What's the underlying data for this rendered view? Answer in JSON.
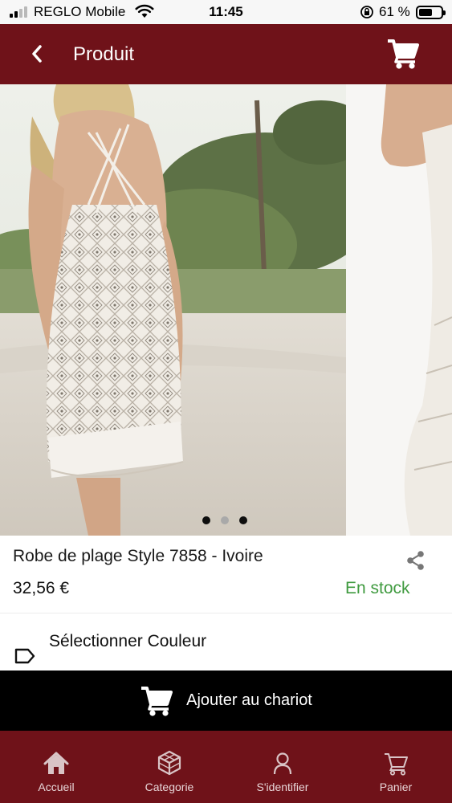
{
  "status_bar": {
    "carrier": "REGLO Mobile",
    "time": "11:45",
    "battery_percent": "61 %",
    "battery_level": 0.61,
    "signal_bars_active": 2,
    "signal_bars_total": 4
  },
  "header": {
    "title": "Produit",
    "back_icon": "chevron-left-icon",
    "cart_icon": "shopping-cart-icon"
  },
  "gallery": {
    "slides": [
      "Dress on beach, back view",
      "Dress on studio background"
    ],
    "active_index": 0,
    "dot_count": 3
  },
  "product": {
    "name": "Robe de plage Style 7858 - Ivoire",
    "price": "32,56 €",
    "stock_status": "En stock",
    "share_icon": "share-icon"
  },
  "options": {
    "color_label": "Sélectionner Couleur",
    "tag_icon": "tag-icon"
  },
  "add_to_cart": {
    "label": "Ajouter au chariot",
    "icon": "shopping-cart-icon"
  },
  "bottom_nav": {
    "items": [
      {
        "label": "Accueil",
        "icon": "home-icon"
      },
      {
        "label": "Categorie",
        "icon": "cube-icon"
      },
      {
        "label": "S'identifier",
        "icon": "user-icon"
      },
      {
        "label": "Panier",
        "icon": "cart-outline-icon"
      }
    ]
  },
  "colors": {
    "brand": "#6f1219",
    "in_stock": "#3f9a3f",
    "cta_background": "#000000",
    "nav_label": "#e8d6d8"
  }
}
